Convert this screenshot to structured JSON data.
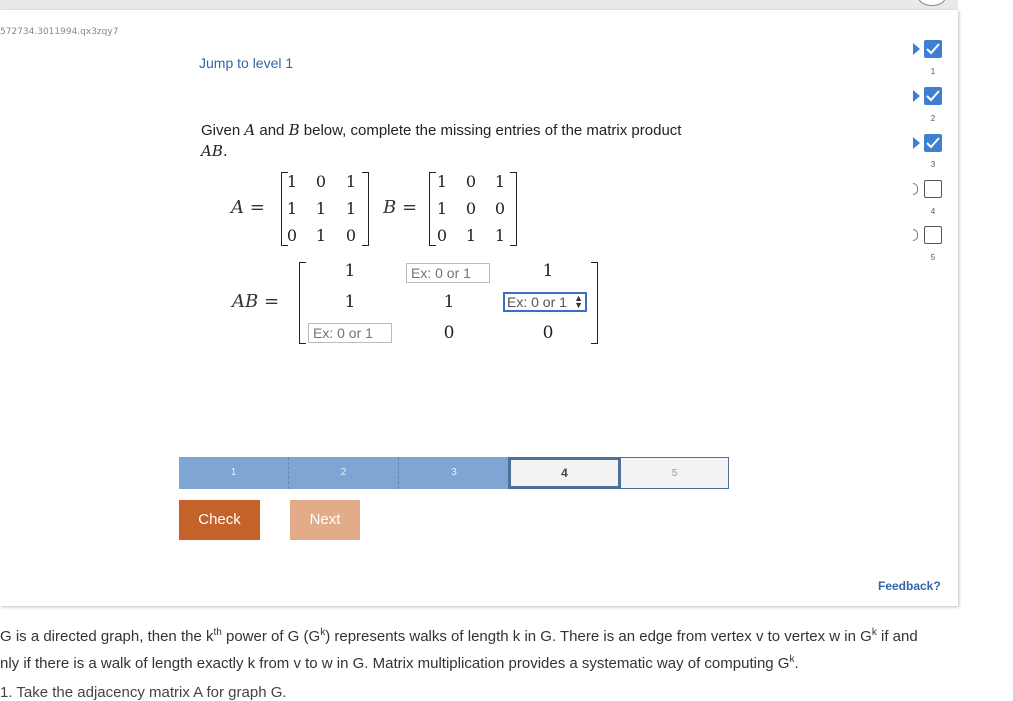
{
  "session_id": "572734.3011994.qx3zqy7",
  "jump_link": "Jump to level 1",
  "prompt": {
    "pre": "Given ",
    "A": "A",
    "and": " and ",
    "B": "B",
    "post": " below, complete the missing entries of the matrix product",
    "AB": "AB",
    "period": "."
  },
  "matrix_A": {
    "label": "A =",
    "rows": [
      [
        "1",
        "0",
        "1"
      ],
      [
        "1",
        "1",
        "1"
      ],
      [
        "0",
        "1",
        "0"
      ]
    ]
  },
  "matrix_B": {
    "label": "B =",
    "rows": [
      [
        "1",
        "0",
        "1"
      ],
      [
        "1",
        "0",
        "0"
      ],
      [
        "0",
        "1",
        "1"
      ]
    ]
  },
  "matrix_AB": {
    "label": "AB =",
    "cells": {
      "r1c1": "1",
      "r1c3": "1",
      "r2c1": "1",
      "r2c2": "1",
      "r3c2": "0",
      "r3c3": "0"
    },
    "inputs": {
      "r1c2": {
        "placeholder": "Ex: 0 or 1",
        "value": ""
      },
      "r2c3": {
        "placeholder": "Ex: 0 or 1",
        "value": ""
      },
      "r3c1": {
        "placeholder": "Ex: 0 or 1",
        "value": ""
      }
    }
  },
  "levels": [
    {
      "label": "1",
      "state": "done"
    },
    {
      "label": "2",
      "state": "done"
    },
    {
      "label": "3",
      "state": "done"
    },
    {
      "label": "4",
      "state": "current"
    },
    {
      "label": "5",
      "state": "todo"
    }
  ],
  "buttons": {
    "check": "Check",
    "next": "Next"
  },
  "feedback": "Feedback?",
  "progress": [
    {
      "num": "1",
      "done": true
    },
    {
      "num": "2",
      "done": true
    },
    {
      "num": "3",
      "done": true
    },
    {
      "num": "4",
      "done": false
    },
    {
      "num": "5",
      "done": false
    }
  ],
  "body": {
    "line1_a": "G is a directed graph, then the k",
    "line1_sup": "th",
    "line1_b": " power of G (G",
    "line1_sup2": "k",
    "line1_c": ") represents walks of length k in G. There is an edge from vertex v to vertex w in G",
    "line1_sup3": "k",
    "line1_d": " if and",
    "line2_a": "nly if there is a walk of length exactly k from v to w in G. Matrix multiplication provides a systematic way of computing G",
    "line2_sup": "k",
    "line2_b": ".",
    "step1": "1. Take the adjacency matrix A for graph G."
  },
  "colors": {
    "link": "#3366a8",
    "check_button": "#c4622a",
    "next_button": "#e2ab8a",
    "level_done": "#7fa5d4",
    "level_border": "#4e6f96",
    "checkbox_on": "#3e7fd2"
  }
}
